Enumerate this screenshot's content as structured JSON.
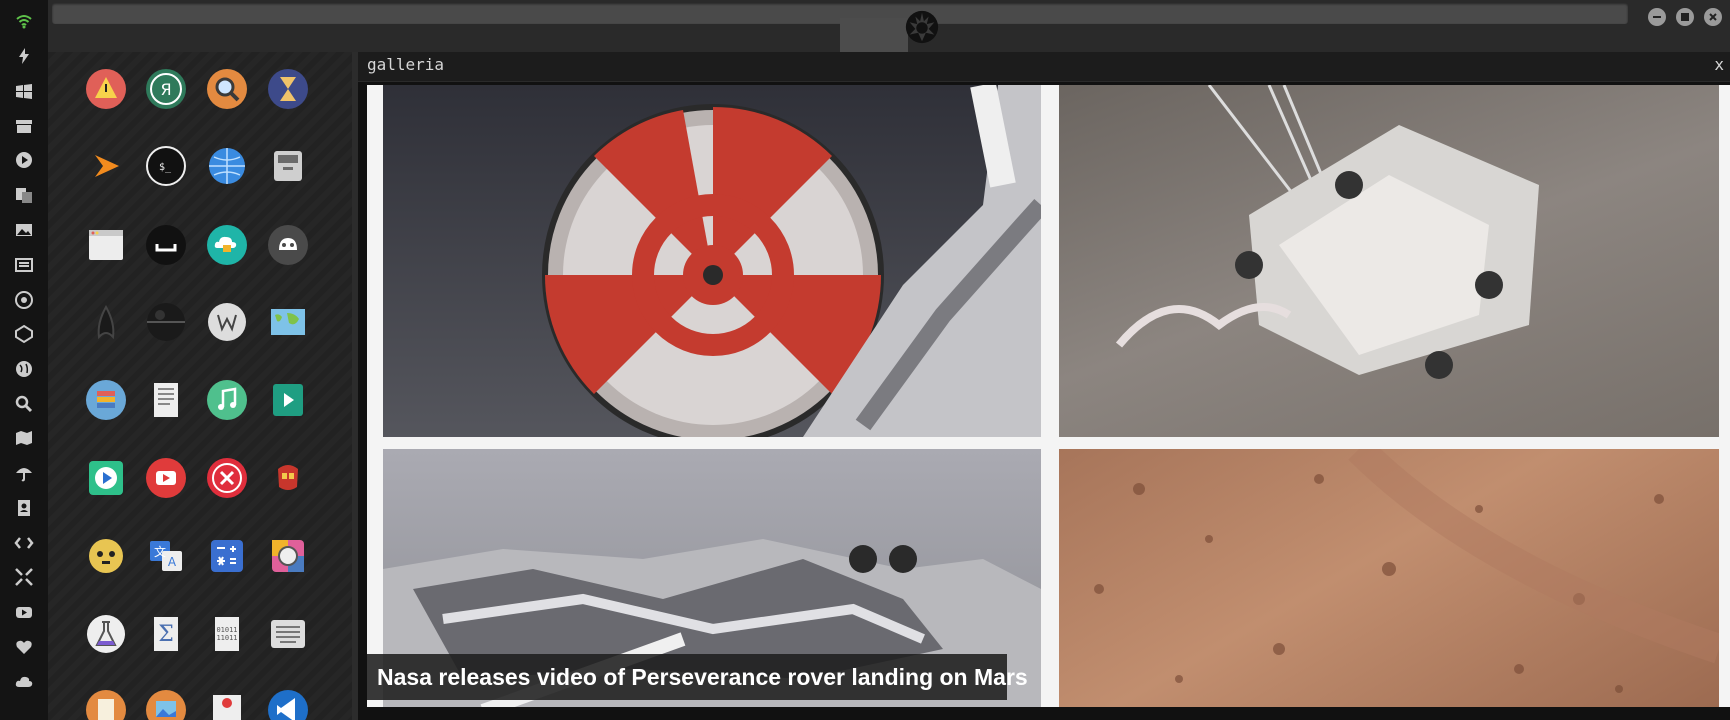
{
  "topbar": {
    "logo": "rebel-alliance-logo"
  },
  "dock": {
    "icons": [
      "wifi-icon",
      "flash-icon",
      "windows-icon",
      "archive-icon",
      "play-icon",
      "translate-icon",
      "image-icon",
      "news-icon",
      "empire-icon",
      "star-wars-icon",
      "globe-icon",
      "search-icon",
      "map-icon",
      "umbrella-icon",
      "contacts-icon",
      "code-icon",
      "fullscreen-icon",
      "youtube-icon",
      "heart-icon",
      "cloud-icon"
    ]
  },
  "launcher": {
    "apps": [
      "warning-app-icon",
      "yandex-app-icon",
      "search-app-icon",
      "hourglass-app-icon",
      "sublime-app-icon",
      "terminal-app-icon",
      "web-browser-app-icon",
      "file-manager-app-icon",
      "window-app-icon",
      "gnome-app-icon",
      "cloud-lock-app-icon",
      "github-app-icon",
      "star-trek-app-icon",
      "death-star-app-icon",
      "wikipedia-app-icon",
      "world-map-app-icon",
      "books-app-icon",
      "document-app-icon",
      "music-app-icon",
      "video-app-icon",
      "media-player-app-icon",
      "youtube-app-icon",
      "close-app-icon",
      "iron-man-app-icon",
      "c3po-app-icon",
      "translator-app-icon",
      "calculator-app-icon",
      "photo-viewer-app-icon",
      "science-app-icon",
      "math-app-icon",
      "binary-app-icon",
      "keyboard-app-icon",
      "notes-app-icon",
      "gallery-app-icon",
      "presentation-app-icon",
      "vscode-app-icon"
    ]
  },
  "gallery": {
    "title": "galleria",
    "close_label": "x",
    "caption": "Nasa releases video of Perseverance rover landing on Mars"
  },
  "colors": {
    "dock_bg": "#141414",
    "topbar_bg": "#2a2a2a",
    "accent_wifi": "#5ec24a"
  }
}
